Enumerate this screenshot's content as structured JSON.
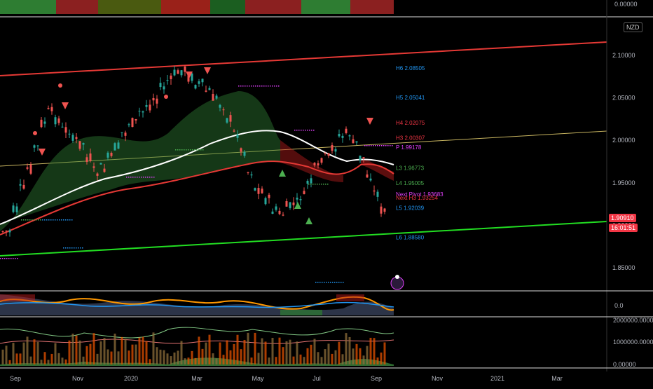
{
  "symbol_badge": "NZD",
  "top_indicator": {
    "axis_label": "0.00000"
  },
  "main_chart": {
    "price_ticks": [
      "2.10000",
      "2.05000",
      "2.00000",
      "1.95000",
      "1.90000",
      "1.85000"
    ],
    "tick_values": [
      2.1,
      2.05,
      2.0,
      1.95,
      1.9,
      1.85
    ],
    "current_price": "1.90910",
    "countdown": "16:01:51",
    "pivot_labels": [
      {
        "text": "H6 2.08505",
        "value": 2.085,
        "color": "#2196f3"
      },
      {
        "text": "H5 2.05041",
        "value": 2.0504,
        "color": "#2196f3"
      },
      {
        "text": "H4 2.02075",
        "value": 2.0207,
        "color": "#f23645"
      },
      {
        "text": "H3 2.00307",
        "value": 2.0031,
        "color": "#f23645"
      },
      {
        "text": "P 1.99178",
        "value": 1.9918,
        "color": "#e040fb"
      },
      {
        "text": "L3 1.96773",
        "value": 1.9677,
        "color": "#4caf50"
      },
      {
        "text": "L4 1.95005",
        "value": 1.95,
        "color": "#4caf50"
      },
      {
        "text": "Next Pivot 1.93683",
        "value": 1.9368,
        "color": "#e040fb"
      },
      {
        "text": "Next H3 1.93254",
        "value": 1.9325,
        "color": "#f23645"
      },
      {
        "text": "L5 1.92039",
        "value": 1.9204,
        "color": "#2196f3"
      },
      {
        "text": "L6 1.88580",
        "value": 1.8858,
        "color": "#2196f3"
      }
    ]
  },
  "oscillator": {
    "axis_label": "0.0"
  },
  "volume_panel": {
    "axis_labels": [
      "2000000.00000",
      "1000000.00000",
      "0.00000"
    ]
  },
  "time_axis": [
    "Sep",
    "Nov",
    "2020",
    "Mar",
    "May",
    "Jul",
    "Sep",
    "Nov",
    "2021",
    "Mar"
  ],
  "colors": {
    "bull": "#26a69a",
    "bear": "#ef5350",
    "channel_top": "#e53935",
    "channel_bottom": "#22dd22",
    "ema": "#ffffff",
    "price_badge": "#f23645"
  }
}
